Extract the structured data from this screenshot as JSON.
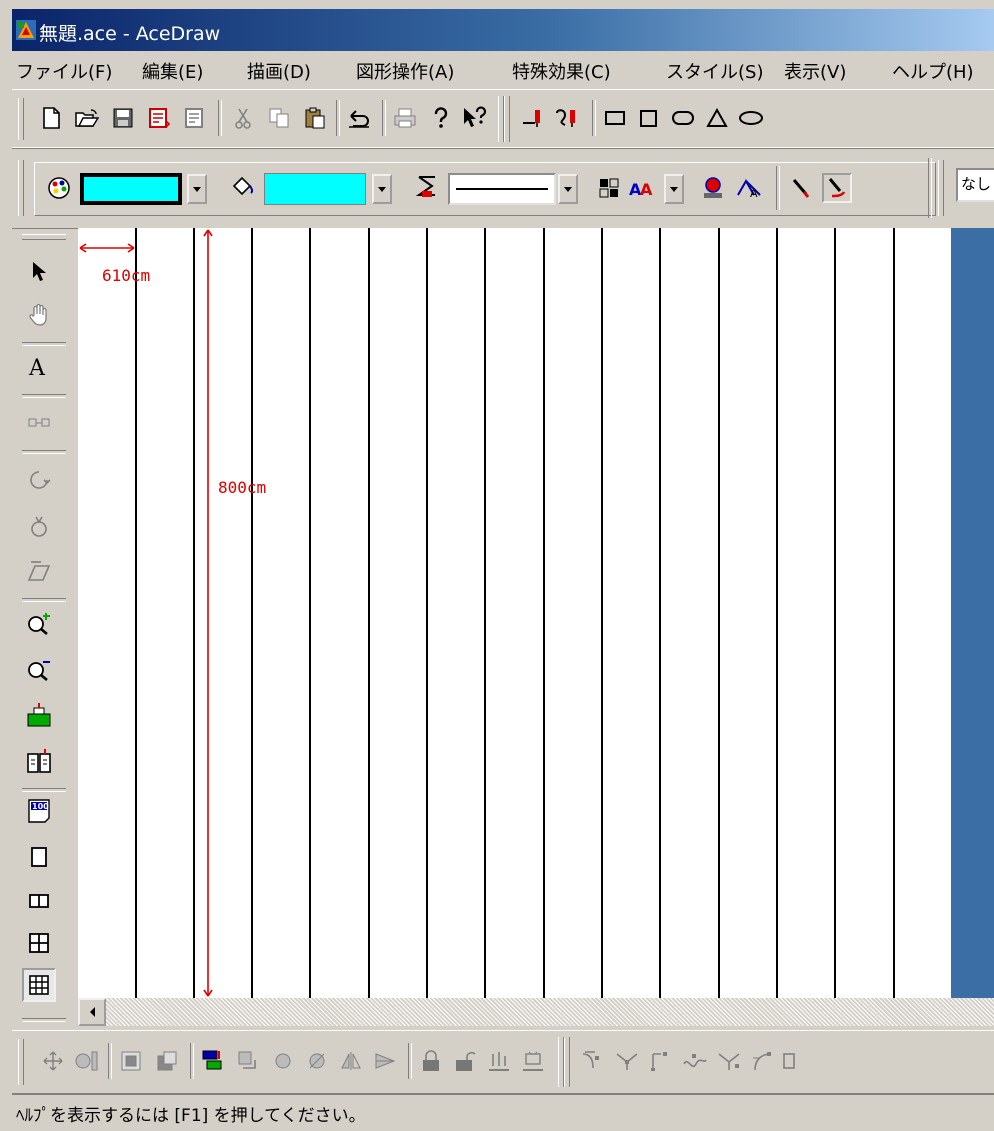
{
  "window": {
    "title": "無題.ace - AceDraw",
    "title_gradient": [
      "#0a246a",
      "#3a6ea5",
      "#a6caf0"
    ]
  },
  "menu": [
    "ファイル(F)",
    "編集(E)",
    "描画(D)",
    "図形操作(A)",
    "特殊効果(C)",
    "スタイル(S)",
    "表示(V)",
    "ヘルプ(H)"
  ],
  "standard_toolbar": [
    "new-icon",
    "open-icon",
    "save-icon",
    "import-icon",
    "export-icon",
    "cut-icon",
    "copy-icon",
    "paste-icon",
    "undo-icon",
    "print-icon",
    "help-icon",
    "context-help-icon",
    "pen-down-icon",
    "pen-curve-icon",
    "rectangle-icon",
    "square-icon",
    "rounded-rect-icon",
    "triangle-icon",
    "ellipse-icon"
  ],
  "style_toolbar": {
    "line_color": "#00ffff",
    "fill_color": "#00ffff",
    "line_style": "solid",
    "font_select_value": "なし"
  },
  "tool_palette": [
    "select-arrow-icon",
    "hand-icon",
    "text-tool-icon",
    "connector-icon",
    "rotate-icon",
    "spin-icon",
    "skew-icon",
    "zoom-in-icon",
    "zoom-out-icon",
    "fit-page-icon",
    "fit-width-icon",
    "zoom-100-icon",
    "page-single-icon",
    "page-double-icon",
    "page-quad-icon",
    "grid-icon"
  ],
  "canvas": {
    "width_dimension_label": "610cm",
    "height_dimension_label": "800cm",
    "dimension_color": "#e00000"
  },
  "bottom_toolbar": [
    "move-icon",
    "align-icon",
    "front-icon",
    "back-icon",
    "order-icon",
    "rotate-left-icon",
    "rotate-right-icon",
    "flip-vertical-icon",
    "flip-horizontal-icon",
    "lock-icon",
    "unlock-icon",
    "group-icon",
    "ungroup-icon",
    "node-edit-1-icon",
    "node-edit-2-icon",
    "node-edit-3-icon",
    "node-edit-4-icon",
    "node-edit-5-icon",
    "node-edit-6-icon"
  ],
  "status_bar": {
    "text": "ﾍﾙﾌﾟを表示するには [F1] を押してください。"
  }
}
